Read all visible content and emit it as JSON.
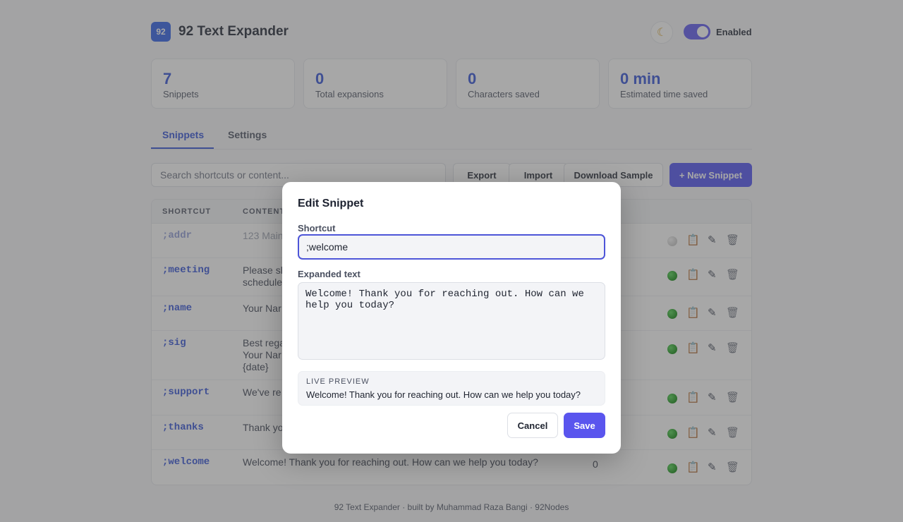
{
  "app": {
    "logo": "92",
    "title": "92 Text Expander",
    "theme_icon": "moon-icon",
    "toggle_label": "Enabled"
  },
  "stats": [
    {
      "value": "7",
      "label": "Snippets"
    },
    {
      "value": "0",
      "label": "Total expansions"
    },
    {
      "value": "0",
      "label": "Characters saved"
    },
    {
      "value": "0 min",
      "label": "Estimated time saved"
    }
  ],
  "tabs": [
    {
      "label": "Snippets",
      "active": true
    },
    {
      "label": "Settings",
      "active": false
    }
  ],
  "toolbar": {
    "search_placeholder": "Search shortcuts or content...",
    "export": "Export",
    "import": "Import",
    "download_sample": "Download Sample",
    "new_snippet": "+ New Snippet"
  },
  "table": {
    "headers": {
      "shortcut": "SHORTCUT",
      "content": "CONTENT"
    },
    "rows": [
      {
        "shortcut": ";addr",
        "content": "123 Main",
        "uses": "",
        "enabled": false
      },
      {
        "shortcut": ";meeting",
        "content": "Please sh\nschedule",
        "uses": "",
        "enabled": true
      },
      {
        "shortcut": ";name",
        "content": "Your Nar",
        "uses": "",
        "enabled": true
      },
      {
        "shortcut": ";sig",
        "content": "Best rega\nYour Nar\n{date}",
        "uses": "",
        "enabled": true
      },
      {
        "shortcut": ";support",
        "content": "We've re",
        "uses": "",
        "enabled": true
      },
      {
        "shortcut": ";thanks",
        "content": "Thank yo",
        "uses": "",
        "enabled": true
      },
      {
        "shortcut": ";welcome",
        "content": "Welcome! Thank you for reaching out. How can we help you today?",
        "uses": "0",
        "enabled": true
      }
    ],
    "action_icons": {
      "copy": "clipboard-icon",
      "edit": "pencil-icon",
      "delete": "trash-icon"
    }
  },
  "footer": "92 Text Expander · built by Muhammad Raza Bangi · 92Nodes",
  "modal": {
    "title": "Edit Snippet",
    "shortcut_label": "Shortcut",
    "shortcut_value": ";welcome",
    "expanded_label": "Expanded text",
    "expanded_value": "Welcome! Thank you for reaching out. How can we help you today?",
    "preview_label": "LIVE PREVIEW",
    "preview_text": "Welcome! Thank you for reaching out. How can we help you today?",
    "cancel": "Cancel",
    "save": "Save"
  }
}
